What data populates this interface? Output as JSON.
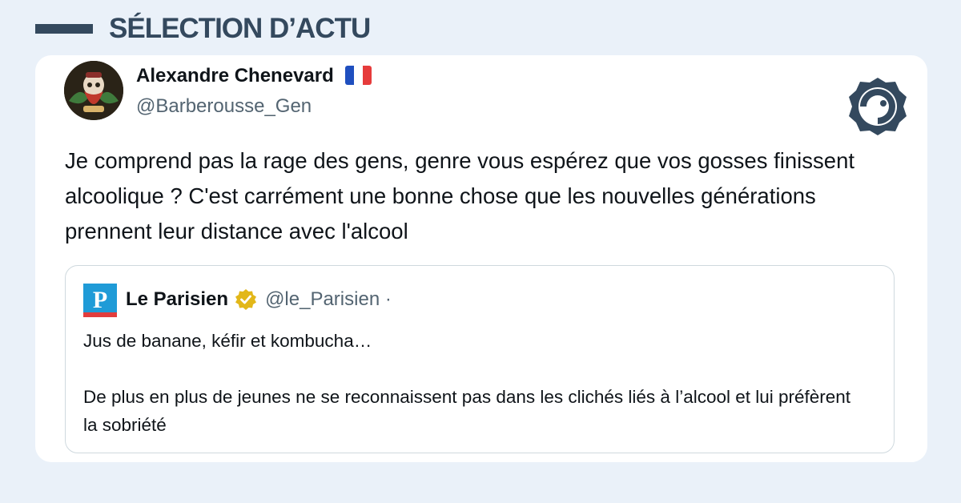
{
  "section": {
    "title": "SÉLECTION D’ACTU"
  },
  "tweet": {
    "author_name": "Alexandre Chenevard",
    "author_handle": "@Barberousse_Gen",
    "text": "Je comprend pas la rage des gens, genre vous espérez que vos gosses finissent alcoolique ? C'est carrément une bonne chose que les nouvelles générations prennent leur distance avec l'alcool"
  },
  "quoted": {
    "name": "Le Parisien",
    "handle": "@le_Parisien ·",
    "line1": "Jus de banane, kéfir et kombucha…",
    "line2": "De plus en plus de jeunes ne se reconnaissent pas dans les clichés liés à l’alcool et lui préfèrent la sobriété"
  },
  "icons": {
    "flag": "france-flag-icon",
    "brand": "brand-logo-icon",
    "verified": "verified-badge-icon",
    "quoted_avatar": "le-parisien-logo-icon"
  },
  "colors": {
    "background": "#eaf1f9",
    "accent": "#34495e",
    "verified": "#e2b719",
    "parisien_blue": "#1f9bd7",
    "parisien_red": "#e23d3d"
  }
}
